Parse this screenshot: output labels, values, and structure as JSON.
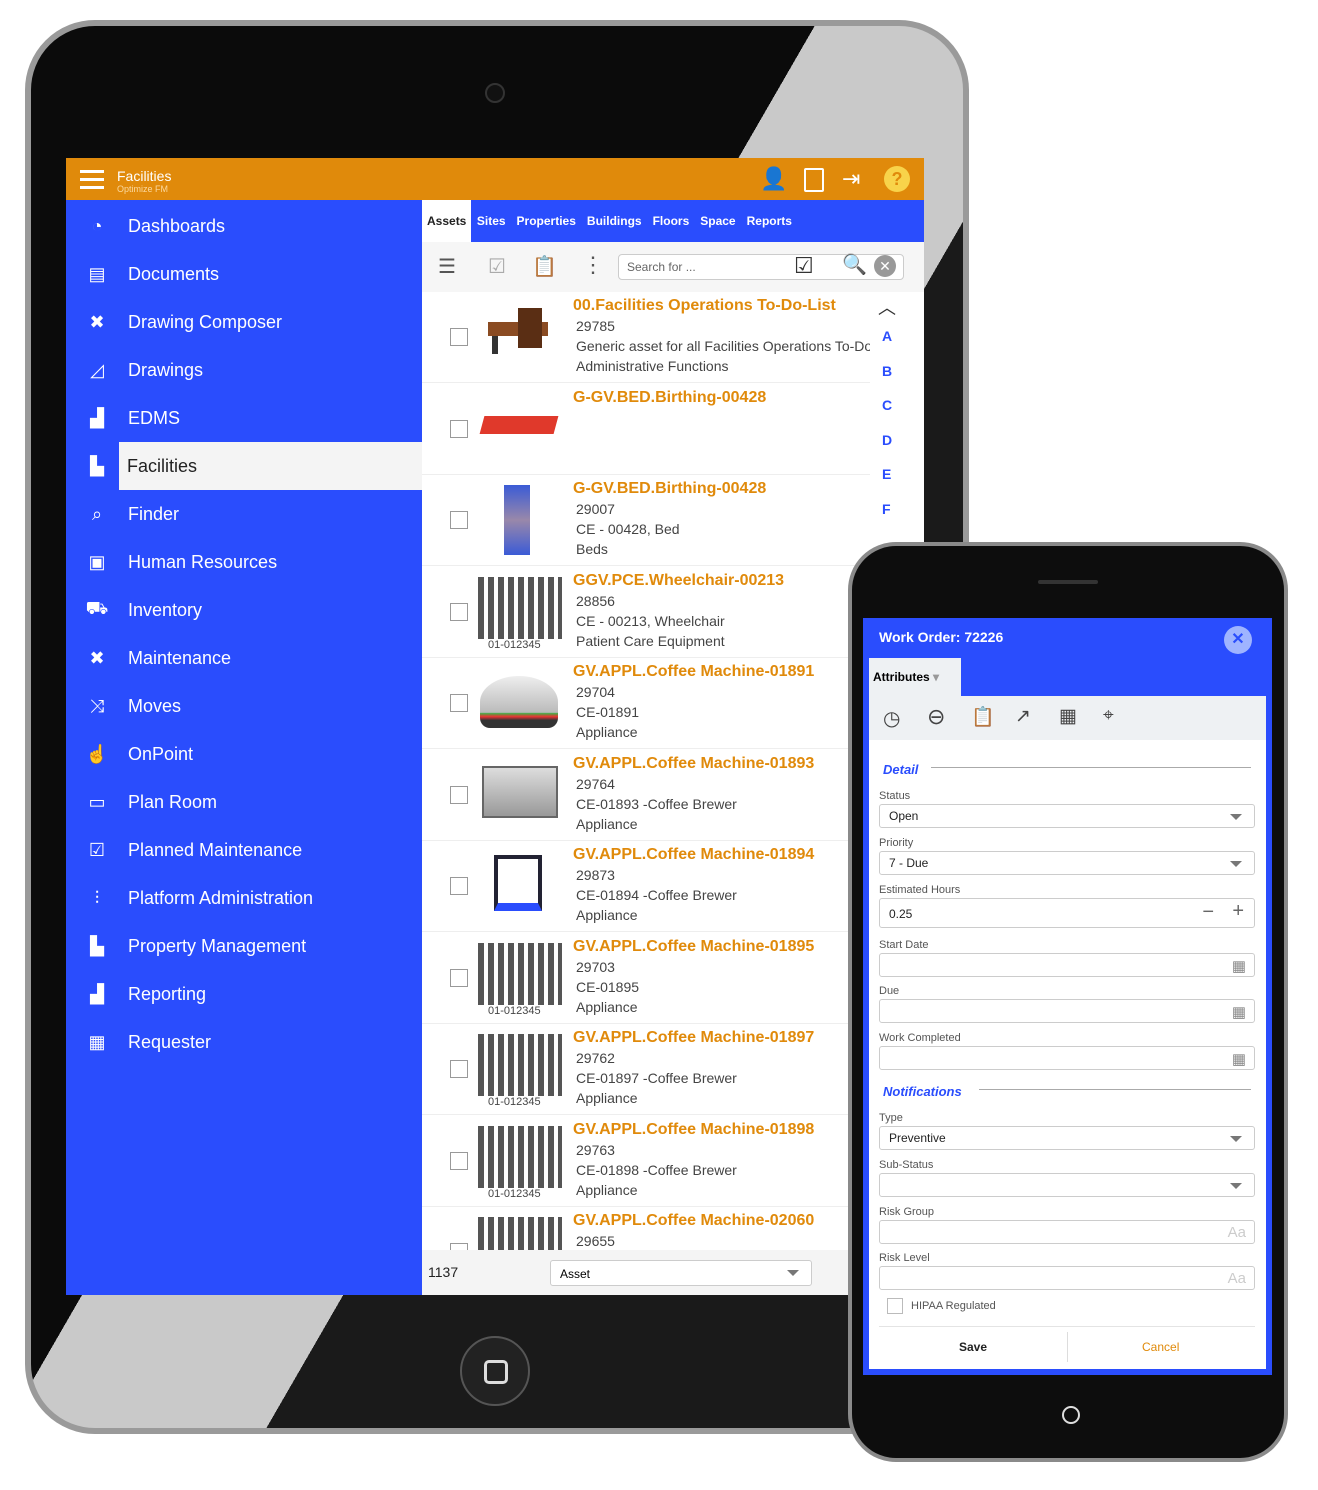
{
  "header": {
    "title": "Facilities",
    "subtitle": "Optimize FM"
  },
  "sidebar": {
    "items": [
      {
        "label": "Dashboards",
        "icon": "gauge-icon"
      },
      {
        "label": "Documents",
        "icon": "documents-icon"
      },
      {
        "label": "Drawing Composer",
        "icon": "tools-icon"
      },
      {
        "label": "Drawings",
        "icon": "drawing-icon"
      },
      {
        "label": "EDMS",
        "icon": "bar-chart-icon"
      },
      {
        "label": "Facilities",
        "icon": "buildings-icon",
        "active": true
      },
      {
        "label": "Finder",
        "icon": "search-icon"
      },
      {
        "label": "Human Resources",
        "icon": "id-card-icon"
      },
      {
        "label": "Inventory",
        "icon": "cart-icon"
      },
      {
        "label": "Maintenance",
        "icon": "tools-icon"
      },
      {
        "label": "Moves",
        "icon": "shuffle-icon"
      },
      {
        "label": "OnPoint",
        "icon": "hand-pointer-icon"
      },
      {
        "label": "Plan Room",
        "icon": "tray-icon"
      },
      {
        "label": "Planned Maintenance",
        "icon": "calendar-check-icon"
      },
      {
        "label": "Platform Administration",
        "icon": "sliders-icon"
      },
      {
        "label": "Property Management",
        "icon": "buildings-icon"
      },
      {
        "label": "Reporting",
        "icon": "bar-chart-icon"
      },
      {
        "label": "Requester",
        "icon": "clipboard-icon"
      }
    ]
  },
  "tabs": [
    {
      "label": "Assets",
      "active": true
    },
    {
      "label": "Sites"
    },
    {
      "label": "Properties"
    },
    {
      "label": "Buildings"
    },
    {
      "label": "Floors"
    },
    {
      "label": "Space"
    },
    {
      "label": "Reports"
    }
  ],
  "search": {
    "placeholder": "Search for ..."
  },
  "list": [
    {
      "title": "00.Facilities Operations To-Do-List",
      "lines": [
        "29785",
        "Generic asset for all Facilities Operations To-Do",
        "Administrative Functions"
      ],
      "thumb": "desk"
    },
    {
      "title": "G-GV.BED.Birthing-00428",
      "lines": [],
      "thumb": "cart"
    },
    {
      "title": "G-GV.BED.Birthing-00428",
      "lines": [
        "29007",
        "CE - 00428, Bed",
        "Beds"
      ],
      "thumb": "machine"
    },
    {
      "title": "GGV.PCE.Wheelchair-00213",
      "lines": [
        "28856",
        "CE - 00213, Wheelchair",
        "Patient Care Equipment"
      ],
      "thumb": "barcode"
    },
    {
      "title": "GV.APPL.Coffee Machine-01891",
      "lines": [
        "29704",
        "CE-01891",
        "Appliance"
      ],
      "thumb": "dome"
    },
    {
      "title": "GV.APPL.Coffee Machine-01893",
      "lines": [
        "29764",
        "CE-01893 -Coffee Brewer",
        "Appliance"
      ],
      "thumb": "box"
    },
    {
      "title": "GV.APPL.Coffee Machine-01894",
      "lines": [
        "29873",
        "CE-01894 -Coffee Brewer",
        "Appliance"
      ],
      "thumb": "trolley"
    },
    {
      "title": "GV.APPL.Coffee Machine-01895",
      "lines": [
        "29703",
        "CE-01895",
        "Appliance"
      ],
      "thumb": "barcode"
    },
    {
      "title": "GV.APPL.Coffee Machine-01897",
      "lines": [
        "29762",
        "CE-01897 -Coffee Brewer",
        "Appliance"
      ],
      "thumb": "barcode"
    },
    {
      "title": "GV.APPL.Coffee Machine-01898",
      "lines": [
        "29763",
        "CE-01898 -Coffee Brewer",
        "Appliance"
      ],
      "thumb": "barcode"
    },
    {
      "title": "GV.APPL.Coffee Machine-02060",
      "lines": [
        "29655"
      ],
      "thumb": "barcode"
    }
  ],
  "barcode_text": "01-012345",
  "alpha": [
    "A",
    "B",
    "C",
    "D",
    "E",
    "F"
  ],
  "footer": {
    "count": "1137",
    "select": "Asset"
  },
  "work_order": {
    "title": "Work Order: 72226",
    "tab": "Attributes",
    "detail_heading": "Detail",
    "status_label": "Status",
    "status": "Open",
    "priority_label": "Priority",
    "priority": "7 - Due",
    "hours_label": "Estimated Hours",
    "hours": "0.25",
    "start_label": "Start Date",
    "due_label": "Due",
    "completed_label": "Work Completed",
    "notif_heading": "Notifications",
    "type_label": "Type",
    "type": "Preventive",
    "substatus_label": "Sub-Status",
    "risk_group_label": "Risk Group",
    "risk_level_label": "Risk Level",
    "hipaa_label": "HIPAA Regulated",
    "save": "Save",
    "cancel": "Cancel",
    "text_icon": "Aa"
  },
  "colors": {
    "accent": "#e08a0b",
    "primary": "#2a4dfd"
  }
}
